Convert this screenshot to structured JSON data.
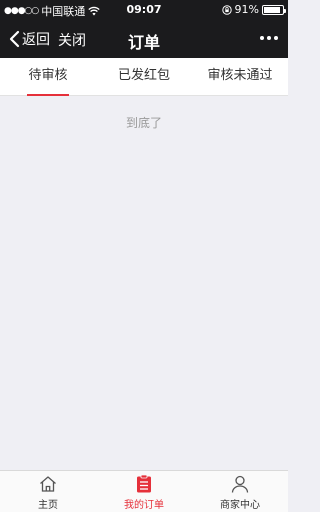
{
  "status_bar": {
    "signal": "●●●○○",
    "carrier": "中国联通",
    "time": "09:07",
    "battery": "91%",
    "battery_level": 0.91
  },
  "nav": {
    "back_label": "返回",
    "close_label": "关闭",
    "title": "订单"
  },
  "tabs": [
    {
      "label": "待审核",
      "active": true
    },
    {
      "label": "已发红包",
      "active": false
    },
    {
      "label": "审核未通过",
      "active": false
    }
  ],
  "content": {
    "end_text": "到底了"
  },
  "tabbar": [
    {
      "label": "主页",
      "icon": "home-icon",
      "active": false
    },
    {
      "label": "我的订单",
      "icon": "order-icon",
      "active": true
    },
    {
      "label": "商家中心",
      "icon": "user-icon",
      "active": false
    }
  ],
  "colors": {
    "accent": "#e5303a",
    "header_bg": "#1b1b1d",
    "page_bg": "#efeff4"
  }
}
